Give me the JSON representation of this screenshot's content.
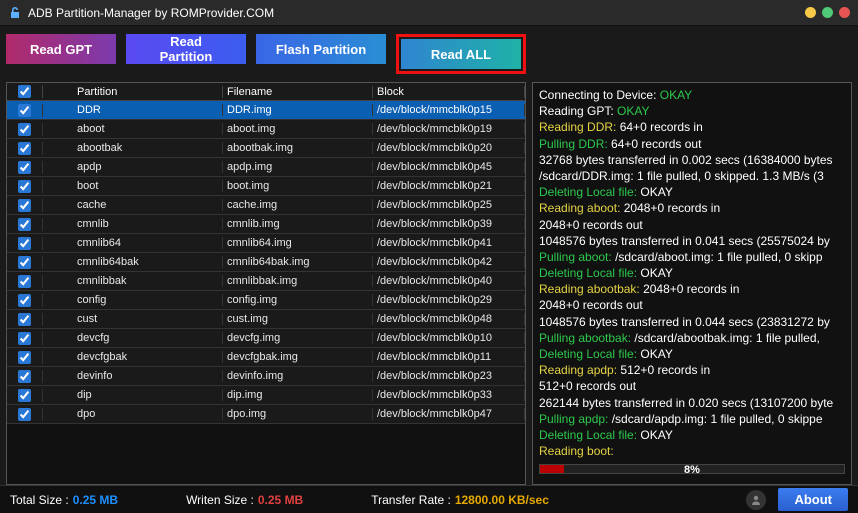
{
  "title": "ADB Partition-Manager by ROMProvider.COM",
  "toolbar": {
    "read_gpt": "Read GPT",
    "read_partition": "Read Partition",
    "flash_partition": "Flash  Partition",
    "read_all": "Read ALL"
  },
  "table": {
    "headers": {
      "checkbox": "",
      "idx": "",
      "partition": "Partition",
      "filename": "Filename",
      "block": "Block"
    },
    "rows": [
      {
        "checked": true,
        "selected": true,
        "partition": "DDR",
        "filename": "DDR.img",
        "block": "/dev/block/mmcblk0p15"
      },
      {
        "checked": true,
        "partition": "aboot",
        "filename": "aboot.img",
        "block": "/dev/block/mmcblk0p19"
      },
      {
        "checked": true,
        "partition": "abootbak",
        "filename": "abootbak.img",
        "block": "/dev/block/mmcblk0p20"
      },
      {
        "checked": true,
        "partition": "apdp",
        "filename": "apdp.img",
        "block": "/dev/block/mmcblk0p45"
      },
      {
        "checked": true,
        "partition": "boot",
        "filename": "boot.img",
        "block": "/dev/block/mmcblk0p21"
      },
      {
        "checked": true,
        "partition": "cache",
        "filename": "cache.img",
        "block": "/dev/block/mmcblk0p25"
      },
      {
        "checked": true,
        "partition": "cmnlib",
        "filename": "cmnlib.img",
        "block": "/dev/block/mmcblk0p39"
      },
      {
        "checked": true,
        "partition": "cmnlib64",
        "filename": "cmnlib64.img",
        "block": "/dev/block/mmcblk0p41"
      },
      {
        "checked": true,
        "partition": "cmnlib64bak",
        "filename": "cmnlib64bak.img",
        "block": "/dev/block/mmcblk0p42"
      },
      {
        "checked": true,
        "partition": "cmnlibbak",
        "filename": "cmnlibbak.img",
        "block": "/dev/block/mmcblk0p40"
      },
      {
        "checked": true,
        "partition": "config",
        "filename": "config.img",
        "block": "/dev/block/mmcblk0p29"
      },
      {
        "checked": true,
        "partition": "cust",
        "filename": "cust.img",
        "block": "/dev/block/mmcblk0p48"
      },
      {
        "checked": true,
        "partition": "devcfg",
        "filename": "devcfg.img",
        "block": "/dev/block/mmcblk0p10"
      },
      {
        "checked": true,
        "partition": "devcfgbak",
        "filename": "devcfgbak.img",
        "block": "/dev/block/mmcblk0p11"
      },
      {
        "checked": true,
        "partition": "devinfo",
        "filename": "devinfo.img",
        "block": "/dev/block/mmcblk0p23"
      },
      {
        "checked": true,
        "partition": "dip",
        "filename": "dip.img",
        "block": "/dev/block/mmcblk0p33"
      },
      {
        "checked": true,
        "partition": "dpo",
        "filename": "dpo.img",
        "block": "/dev/block/mmcblk0p47"
      }
    ]
  },
  "log": [
    {
      "segments": [
        {
          "t": "Connecting to Device: ",
          "c": "white"
        },
        {
          "t": "OKAY",
          "c": "green"
        }
      ]
    },
    {
      "segments": [
        {
          "t": "Reading GPT: ",
          "c": "white"
        },
        {
          "t": "OKAY",
          "c": "green"
        }
      ]
    },
    {
      "segments": [
        {
          "t": "Reading DDR:",
          "c": "yellow"
        },
        {
          "t": " 64+0 records in",
          "c": "white"
        }
      ]
    },
    {
      "segments": [
        {
          "t": "Pulling DDR:",
          "c": "green"
        },
        {
          "t": " 64+0 records out",
          "c": "white"
        }
      ]
    },
    {
      "segments": [
        {
          "t": "32768 bytes transferred in 0.002 secs (16384000 bytes",
          "c": "white"
        }
      ]
    },
    {
      "segments": [
        {
          "t": "/sdcard/DDR.img: 1 file pulled, 0 skipped. 1.3 MB/s (3",
          "c": "white"
        }
      ]
    },
    {
      "segments": [
        {
          "t": "Deleting Local file:",
          "c": "green"
        },
        {
          "t": " OKAY",
          "c": "white"
        }
      ]
    },
    {
      "segments": [
        {
          "t": "Reading aboot:",
          "c": "yellow"
        },
        {
          "t": " 2048+0 records in",
          "c": "white"
        }
      ]
    },
    {
      "segments": [
        {
          "t": "2048+0 records out",
          "c": "white"
        }
      ]
    },
    {
      "segments": [
        {
          "t": "1048576 bytes transferred in 0.041 secs (25575024 by",
          "c": "white"
        }
      ]
    },
    {
      "segments": [
        {
          "t": "Pulling aboot:",
          "c": "green"
        },
        {
          "t": " /sdcard/aboot.img: 1 file pulled, 0 skipp",
          "c": "white"
        }
      ]
    },
    {
      "segments": [
        {
          "t": "Deleting Local file:",
          "c": "green"
        },
        {
          "t": " OKAY",
          "c": "white"
        }
      ]
    },
    {
      "segments": [
        {
          "t": "Reading abootbak:",
          "c": "yellow"
        },
        {
          "t": " 2048+0 records in",
          "c": "white"
        }
      ]
    },
    {
      "segments": [
        {
          "t": "2048+0 records out",
          "c": "white"
        }
      ]
    },
    {
      "segments": [
        {
          "t": "1048576 bytes transferred in 0.044 secs (23831272 by",
          "c": "white"
        }
      ]
    },
    {
      "segments": [
        {
          "t": "Pulling abootbak:",
          "c": "green"
        },
        {
          "t": " /sdcard/abootbak.img: 1 file pulled,",
          "c": "white"
        }
      ]
    },
    {
      "segments": [
        {
          "t": "Deleting Local file:",
          "c": "green"
        },
        {
          "t": " OKAY",
          "c": "white"
        }
      ]
    },
    {
      "segments": [
        {
          "t": "Reading apdp:",
          "c": "yellow"
        },
        {
          "t": " 512+0 records in",
          "c": "white"
        }
      ]
    },
    {
      "segments": [
        {
          "t": "512+0 records out",
          "c": "white"
        }
      ]
    },
    {
      "segments": [
        {
          "t": "262144 bytes transferred in 0.020 secs (13107200 byte",
          "c": "white"
        }
      ]
    },
    {
      "segments": [
        {
          "t": "Pulling apdp:",
          "c": "green"
        },
        {
          "t": " /sdcard/apdp.img: 1 file pulled, 0 skippe",
          "c": "white"
        }
      ]
    },
    {
      "segments": [
        {
          "t": "Deleting Local file:",
          "c": "green"
        },
        {
          "t": " OKAY",
          "c": "white"
        }
      ]
    },
    {
      "segments": [
        {
          "t": "Reading boot:",
          "c": "yellow"
        }
      ]
    }
  ],
  "progress": {
    "percent": 8,
    "label": "8%"
  },
  "status": {
    "total_size_label": "Total Size :",
    "total_size": "0.25 MB",
    "written_size_label": "Writen Size :",
    "written_size": "0.25 MB",
    "transfer_rate_label": "Transfer Rate :",
    "transfer_rate": "12800.00 KB/sec",
    "about": "About"
  }
}
